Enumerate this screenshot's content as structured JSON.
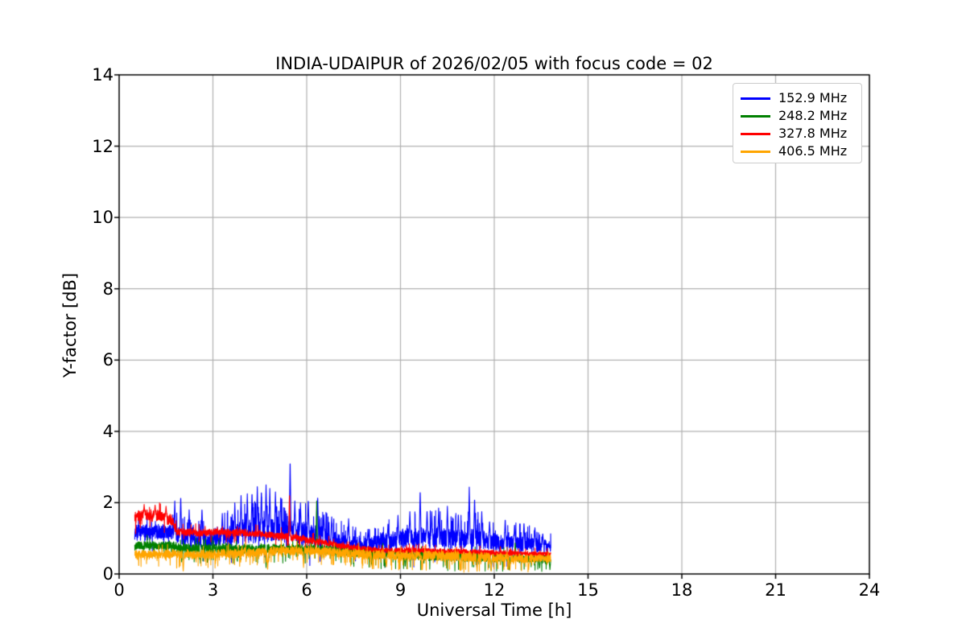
{
  "figure": {
    "background": "#ffffff",
    "frame_color": "#000000"
  },
  "chart_data": {
    "type": "line",
    "title": "INDIA-UDAIPUR of 2026/02/05 with focus code = 02",
    "xlabel": "Universal Time [h]",
    "ylabel": "Y-factor [dB]",
    "xlim": [
      0,
      24
    ],
    "ylim": [
      0,
      14
    ],
    "xticks": [
      0,
      3,
      6,
      9,
      12,
      15,
      18,
      21,
      24
    ],
    "yticks": [
      0,
      2,
      4,
      6,
      8,
      10,
      12,
      14
    ],
    "grid": true,
    "grid_color": "#b0b0b0",
    "legend_position": "upper right",
    "x_start": 0.5,
    "x_end": 13.81,
    "sample_step": 0.004,
    "series": [
      {
        "name": "152.9 MHz",
        "color": "#0000ff",
        "seed": 7,
        "burst_up": 0.06,
        "burst_down": 0.012,
        "envelope": [
          [
            0.5,
            1.15,
            0.25
          ],
          [
            1.7,
            1.18,
            0.25
          ],
          [
            1.85,
            1.1,
            0.3
          ],
          [
            2.3,
            0.95,
            0.25
          ],
          [
            3.2,
            1.0,
            0.3
          ],
          [
            3.9,
            1.15,
            0.4
          ],
          [
            4.6,
            1.25,
            0.45
          ],
          [
            5.5,
            1.2,
            0.4
          ],
          [
            6.3,
            1.1,
            0.38
          ],
          [
            7.0,
            0.92,
            0.28
          ],
          [
            7.7,
            0.82,
            0.2
          ],
          [
            8.4,
            0.88,
            0.28
          ],
          [
            9.2,
            1.0,
            0.33
          ],
          [
            10.0,
            1.02,
            0.36
          ],
          [
            10.8,
            0.98,
            0.33
          ],
          [
            11.4,
            1.0,
            0.36
          ],
          [
            12.1,
            0.88,
            0.28
          ],
          [
            12.9,
            0.84,
            0.26
          ],
          [
            13.81,
            0.75,
            0.2
          ]
        ],
        "spikes": [
          [
            1.78,
            2.05
          ],
          [
            1.97,
            2.2
          ],
          [
            2.24,
            1.8
          ],
          [
            2.65,
            1.85
          ],
          [
            3.3,
            1.7
          ],
          [
            3.7,
            2.0
          ],
          [
            3.9,
            2.2
          ],
          [
            4.1,
            2.25
          ],
          [
            4.25,
            2.3
          ],
          [
            4.42,
            2.45
          ],
          [
            4.55,
            2.35
          ],
          [
            4.7,
            2.5
          ],
          [
            4.82,
            2.4
          ],
          [
            5.0,
            2.3
          ],
          [
            5.17,
            2.2
          ],
          [
            5.47,
            3.22
          ],
          [
            5.62,
            2.05
          ],
          [
            5.8,
            2.0
          ],
          [
            6.05,
            2.1
          ],
          [
            6.35,
            2.2
          ],
          [
            6.55,
            1.7
          ],
          [
            6.8,
            1.6
          ],
          [
            7.34,
            1.55
          ],
          [
            7.96,
            1.25
          ],
          [
            8.6,
            1.4
          ],
          [
            8.92,
            1.65
          ],
          [
            9.3,
            1.75
          ],
          [
            9.63,
            2.37
          ],
          [
            9.85,
            1.8
          ],
          [
            10.0,
            1.75
          ],
          [
            10.22,
            1.85
          ],
          [
            10.5,
            1.9
          ],
          [
            10.85,
            1.7
          ],
          [
            11.2,
            2.44
          ],
          [
            11.37,
            2.15
          ],
          [
            11.6,
            1.75
          ],
          [
            11.85,
            1.5
          ],
          [
            12.35,
            1.55
          ],
          [
            12.65,
            1.4
          ],
          [
            12.95,
            1.45
          ],
          [
            13.3,
            1.3
          ],
          [
            13.55,
            1.15
          ]
        ]
      },
      {
        "name": "248.2 MHz",
        "color": "#008000",
        "seed": 13,
        "burst_up": 0.01,
        "burst_down": 0.04,
        "envelope": [
          [
            0.5,
            0.8,
            0.14
          ],
          [
            1.75,
            0.8,
            0.14
          ],
          [
            2.0,
            0.72,
            0.16
          ],
          [
            3.5,
            0.7,
            0.16
          ],
          [
            5.0,
            0.72,
            0.16
          ],
          [
            6.5,
            0.7,
            0.16
          ],
          [
            7.5,
            0.62,
            0.16
          ],
          [
            8.5,
            0.55,
            0.16
          ],
          [
            9.5,
            0.52,
            0.16
          ],
          [
            10.5,
            0.5,
            0.16
          ],
          [
            11.5,
            0.46,
            0.15
          ],
          [
            12.5,
            0.44,
            0.14
          ],
          [
            13.81,
            0.42,
            0.14
          ]
        ],
        "spikes": [
          [
            6.32,
            2.05
          ],
          [
            2.6,
            0.3
          ],
          [
            4.7,
            0.18
          ],
          [
            8.5,
            0.18
          ],
          [
            9.15,
            0.2
          ],
          [
            11.9,
            0.1
          ],
          [
            12.67,
            0.9
          ],
          [
            13.45,
            0.15
          ],
          [
            13.78,
            0.12
          ]
        ]
      },
      {
        "name": "327.8 MHz",
        "color": "#ff0000",
        "seed": 3,
        "burst_up": 0.02,
        "burst_down": 0.012,
        "envelope": [
          [
            0.5,
            1.6,
            0.2
          ],
          [
            0.9,
            1.65,
            0.2
          ],
          [
            1.4,
            1.6,
            0.2
          ],
          [
            1.72,
            1.5,
            0.2
          ],
          [
            1.82,
            1.2,
            0.14
          ],
          [
            2.5,
            1.15,
            0.12
          ],
          [
            3.3,
            1.17,
            0.12
          ],
          [
            4.2,
            1.15,
            0.12
          ],
          [
            5.0,
            1.08,
            0.12
          ],
          [
            5.8,
            1.0,
            0.12
          ],
          [
            6.4,
            0.9,
            0.11
          ],
          [
            7.0,
            0.8,
            0.1
          ],
          [
            7.8,
            0.7,
            0.09
          ],
          [
            8.6,
            0.66,
            0.09
          ],
          [
            9.6,
            0.65,
            0.09
          ],
          [
            10.6,
            0.63,
            0.09
          ],
          [
            11.6,
            0.6,
            0.09
          ],
          [
            12.6,
            0.58,
            0.08
          ],
          [
            13.81,
            0.55,
            0.08
          ]
        ],
        "spikes": [
          [
            0.8,
            1.95
          ],
          [
            1.15,
            1.95
          ],
          [
            1.5,
            1.9
          ],
          [
            5.45,
            2.28
          ]
        ]
      },
      {
        "name": "406.5 MHz",
        "color": "#ffa500",
        "seed": 21,
        "burst_up": 0.01,
        "burst_down": 0.05,
        "envelope": [
          [
            0.5,
            0.55,
            0.15
          ],
          [
            1.75,
            0.55,
            0.15
          ],
          [
            3.0,
            0.55,
            0.15
          ],
          [
            4.2,
            0.6,
            0.15
          ],
          [
            5.2,
            0.66,
            0.15
          ],
          [
            6.2,
            0.66,
            0.15
          ],
          [
            7.0,
            0.6,
            0.15
          ],
          [
            8.0,
            0.55,
            0.16
          ],
          [
            9.0,
            0.5,
            0.16
          ],
          [
            10.0,
            0.52,
            0.16
          ],
          [
            11.0,
            0.48,
            0.17
          ],
          [
            12.0,
            0.46,
            0.16
          ],
          [
            13.0,
            0.44,
            0.15
          ],
          [
            13.81,
            0.44,
            0.14
          ]
        ],
        "spikes": [
          [
            2.05,
            0.05
          ],
          [
            4.75,
            0.1
          ],
          [
            5.9,
            0.18
          ],
          [
            8.1,
            0.15
          ],
          [
            8.55,
            0.18
          ],
          [
            9.7,
            0.12
          ],
          [
            10.9,
            0.1
          ],
          [
            11.45,
            0.05
          ],
          [
            11.9,
            0.08
          ],
          [
            12.5,
            0.1
          ],
          [
            13.1,
            0.12
          ]
        ]
      }
    ]
  }
}
